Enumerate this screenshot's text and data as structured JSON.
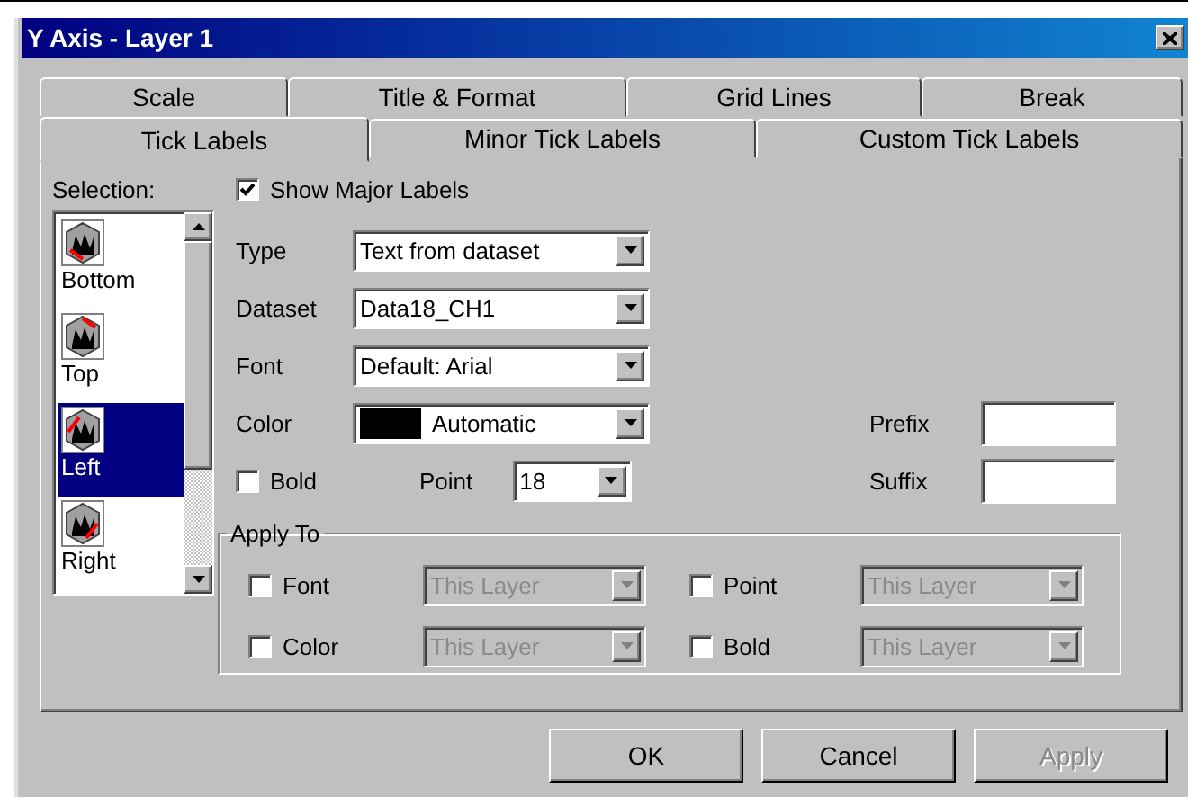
{
  "window": {
    "title": "Y Axis - Layer 1"
  },
  "tab_rows": [
    [
      {
        "label": "Scale",
        "selected": false
      },
      {
        "label": "Title & Format",
        "selected": false
      },
      {
        "label": "Grid Lines",
        "selected": false
      },
      {
        "label": "Break",
        "selected": false
      }
    ],
    [
      {
        "label": "Tick Labels",
        "selected": true
      },
      {
        "label": "Minor Tick Labels",
        "selected": false
      },
      {
        "label": "Custom Tick Labels",
        "selected": false
      }
    ]
  ],
  "selection": {
    "label": "Selection:",
    "items": [
      {
        "label": "Bottom",
        "kind": "bottom",
        "selected": false
      },
      {
        "label": "Top",
        "kind": "top",
        "selected": false
      },
      {
        "label": "Left",
        "kind": "left",
        "selected": true
      },
      {
        "label": "Right",
        "kind": "right",
        "selected": false
      }
    ]
  },
  "show_major_labels": {
    "label": "Show Major Labels",
    "checked": true
  },
  "fields": [
    {
      "label": "Type",
      "value": "Text from dataset"
    },
    {
      "label": "Dataset",
      "value": "Data18_CH1"
    },
    {
      "label": "Font",
      "value": "Default: Arial"
    },
    {
      "label": "Color",
      "value": "Automatic",
      "color": "#000000"
    }
  ],
  "bold": {
    "label": "Bold",
    "checked": false
  },
  "point": {
    "label": "Point",
    "value": "18"
  },
  "prefix": {
    "label": "Prefix"
  },
  "suffix": {
    "label": "Suffix"
  },
  "apply_to": {
    "title": "Apply To",
    "items": [
      {
        "label": "Font",
        "checked": false,
        "value": "This Layer",
        "disabled": true
      },
      {
        "label": "Point",
        "checked": false,
        "value": "This Layer",
        "disabled": true
      },
      {
        "label": "Color",
        "checked": false,
        "value": "This Layer",
        "disabled": true
      },
      {
        "label": "Bold",
        "checked": false,
        "value": "This Layer",
        "disabled": true
      }
    ]
  },
  "buttons": [
    {
      "label": "OK",
      "disabled": false
    },
    {
      "label": "Cancel",
      "disabled": false
    },
    {
      "label": "Apply",
      "disabled": true
    }
  ]
}
